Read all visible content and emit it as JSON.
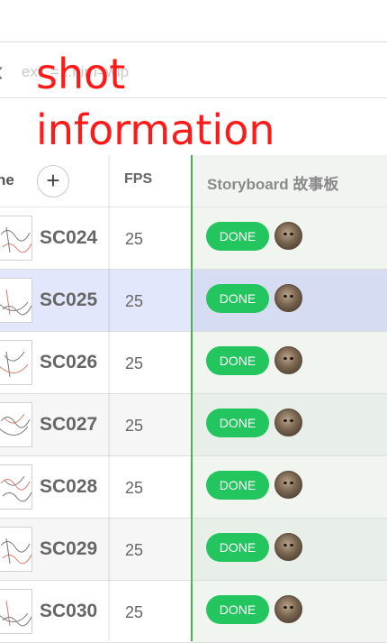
{
  "filter": {
    "value": "ex...=...nim=wip"
  },
  "overlay": {
    "line1": "shot",
    "line2": "information"
  },
  "table": {
    "columns": {
      "name": "ne",
      "add": "+",
      "fps": "FPS",
      "storyboard": "Storyboard 故事板"
    },
    "rows": [
      {
        "name": "SC024",
        "fps": "25",
        "status": "DONE",
        "selected": false
      },
      {
        "name": "SC025",
        "fps": "25",
        "status": "DONE",
        "selected": true
      },
      {
        "name": "SC026",
        "fps": "25",
        "status": "DONE",
        "selected": false
      },
      {
        "name": "SC027",
        "fps": "25",
        "status": "DONE",
        "selected": false
      },
      {
        "name": "SC028",
        "fps": "25",
        "status": "DONE",
        "selected": false
      },
      {
        "name": "SC029",
        "fps": "25",
        "status": "DONE",
        "selected": false
      },
      {
        "name": "SC030",
        "fps": "25",
        "status": "DONE",
        "selected": false
      }
    ]
  },
  "colors": {
    "done": "#22c55e",
    "overlay": "#ff1a1a",
    "separator": "#4caf50",
    "selected": "#e3e7fb"
  },
  "icons": {
    "filter": "chevron-left-icon",
    "add": "plus-icon",
    "avatar": "cat-avatar",
    "thumb": "storyboard-thumbnail"
  }
}
